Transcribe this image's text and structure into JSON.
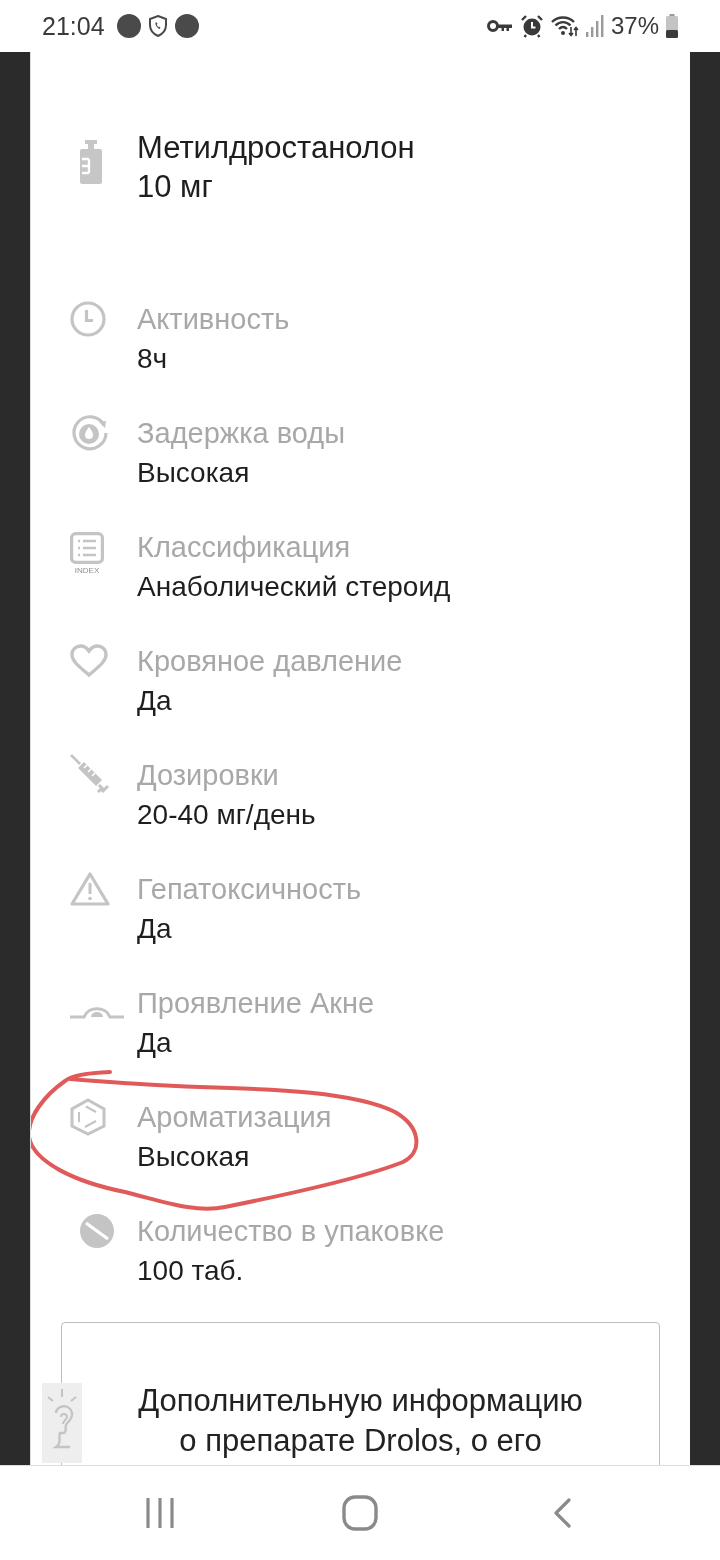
{
  "status_bar": {
    "time": "21:04",
    "battery": "37%"
  },
  "drug": {
    "name": "Метилдростанолон",
    "dose": "10 мг"
  },
  "properties": [
    {
      "label": "Активность",
      "value": "8ч",
      "circled": false
    },
    {
      "label": "Задержка воды",
      "value": "Высокая",
      "circled": false
    },
    {
      "label": "Классификация",
      "value": "Анаболический стероид",
      "icon_text": "INDEX",
      "circled": false
    },
    {
      "label": "Кровяное давление",
      "value": "Да",
      "circled": false
    },
    {
      "label": "Дозировки",
      "value": "20-40 мг/день",
      "circled": false
    },
    {
      "label": "Гепатоксичность",
      "value": "Да",
      "circled": false
    },
    {
      "label": "Проявление Акне",
      "value": "Да",
      "circled": false
    },
    {
      "label": "Ароматизация",
      "value": "Высокая",
      "circled": true
    },
    {
      "label": "Количество в упаковке",
      "value": "100 таб.",
      "circled": false
    }
  ],
  "info_box": {
    "text": "Дополнительную информацию\nо препарате Drolos, о его"
  }
}
